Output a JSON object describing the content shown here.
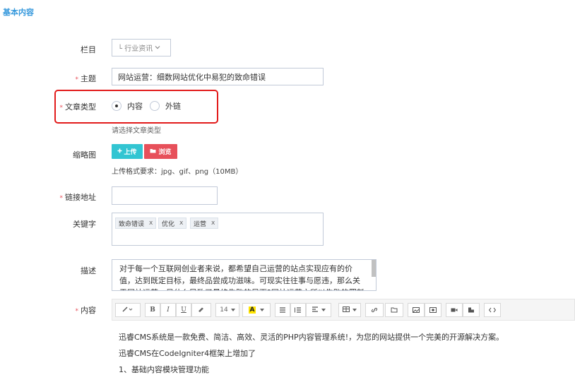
{
  "section_title": "基本内容",
  "fields": {
    "column": {
      "label": "栏目",
      "value": "└ 行业资讯"
    },
    "subject": {
      "label": "主题",
      "value": "网站运营：细数网站优化中易犯的致命错误"
    },
    "article_type": {
      "label": "文章类型",
      "options": [
        "内容",
        "外链"
      ],
      "selected": "内容",
      "help": "请选择文章类型"
    },
    "thumbnail": {
      "label": "缩略图",
      "upload_label": "上传",
      "browse_label": "浏览",
      "help": "上传格式要求：jpg、gif、png（10MB）"
    },
    "link": {
      "label": "链接地址",
      "value": ""
    },
    "keywords": {
      "label": "关键字",
      "tags": [
        "致命错误",
        "优化",
        "运营"
      ],
      "remove_glyph": "x"
    },
    "description": {
      "label": "描述",
      "text": "对于每一个互联网创业者来说，都希望自己运营的站点实现应有的价值，达到既定目标，最终品尝成功滋味。可现实往往事与愿违，那么关于网站运营，是什么导致了最终失败的局面?网站运营之所以失败的罪魁祸首到底是"
    },
    "content": {
      "label": "内容",
      "toolbar": {
        "font_size": "14"
      },
      "paragraphs": [
        "迅睿CMS系统是一款免费、简洁、高效、灵活的PHP内容管理系统!，为您的网站提供一个完美的开源解决方案。",
        "迅睿CMS在CodeIgniter4框架上增加了",
        "1、基础内容模块管理功能"
      ]
    }
  },
  "colors": {
    "accent": "#3598dc",
    "danger": "#e7505a",
    "highlight": "#e21b1b"
  },
  "icons": [
    "chevron-down-icon",
    "radio-icon",
    "plus-icon",
    "folder-icon",
    "remove-tag-icon",
    "magic-wand-icon",
    "bold-icon",
    "italic-icon",
    "underline-icon",
    "eraser-icon",
    "font-color-icon",
    "unordered-list-icon",
    "ordered-list-icon",
    "align-icon",
    "table-icon",
    "link-icon",
    "file-icon",
    "picture-icon",
    "image-icon",
    "video-icon",
    "attachment-icon",
    "code-view-icon"
  ]
}
